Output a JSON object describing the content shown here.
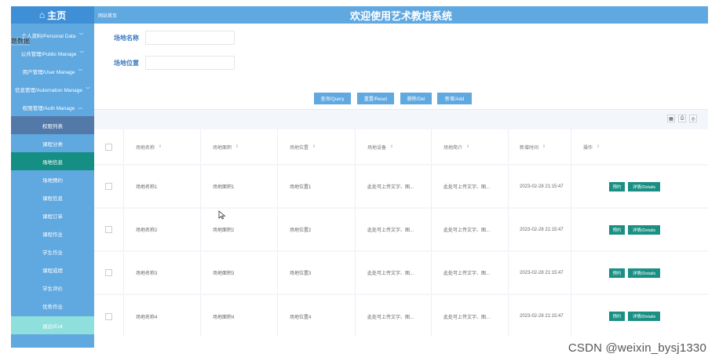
{
  "sidebar": {
    "title": "主页",
    "home_icon": "home-icon",
    "overlay_label": "题数据",
    "sections": [
      {
        "label": "个人资料/Personal Data"
      },
      {
        "label": "公共管理/Public Manage"
      },
      {
        "label": "用户管理/User Manage"
      },
      {
        "label": "信息管理/Automation Manage"
      },
      {
        "label": "权限管理/Auth Manage"
      }
    ],
    "items": [
      {
        "label": "权限列表"
      },
      {
        "label": "课程分类"
      },
      {
        "label": "场地信息"
      },
      {
        "label": "场地预约"
      },
      {
        "label": "课程信息"
      },
      {
        "label": "课程订单"
      },
      {
        "label": "课程作业"
      },
      {
        "label": "学生作业"
      },
      {
        "label": "课程成绩"
      },
      {
        "label": "学生评价"
      },
      {
        "label": "优秀作业"
      },
      {
        "label": "退出/Exit"
      }
    ]
  },
  "header": {
    "breadcrumb": "网站首页",
    "title": "欢迎使用艺术教培系统"
  },
  "filters": {
    "venue_name_label": "场地名称",
    "venue_name_value": "",
    "venue_location_label": "场地位置",
    "venue_location_value": ""
  },
  "actions": {
    "query": "查询/Query",
    "reset": "重置/Reset",
    "delete": "删除/Del",
    "add": "新增/Add"
  },
  "table": {
    "columns": [
      "场地名称",
      "场地面积",
      "场地位置",
      "场地设备",
      "场地简介",
      "新增时间",
      "操作"
    ],
    "sort_symbol": "⇕",
    "rows": [
      {
        "name": "场地名称1",
        "area": "场地面积1",
        "location": "场地位置1",
        "equipment": "此处可上传文字、图...",
        "intro": "此处可上传文字、图...",
        "time": "2023-02-28 21:15:47"
      },
      {
        "name": "场地名称2",
        "area": "场地面积2",
        "location": "场地位置2",
        "equipment": "此处可上传文字、图...",
        "intro": "此处可上传文字、图...",
        "time": "2023-02-28 21:15:47"
      },
      {
        "name": "场地名称3",
        "area": "场地面积3",
        "location": "场地位置3",
        "equipment": "此处可上传文字、图...",
        "intro": "此处可上传文字、图...",
        "time": "2023-02-28 21:15:47"
      },
      {
        "name": "场地名称4",
        "area": "场地面积4",
        "location": "场地位置4",
        "equipment": "此处可上传文字、图...",
        "intro": "此处可上传文字、图...",
        "time": "2023-02-28 21:15:47"
      }
    ],
    "row_actions": {
      "book": "预约",
      "details": "详情/Details"
    }
  },
  "toolbar_icons": [
    "column-toggle-icon",
    "print-icon",
    "export-icon"
  ],
  "watermark": "CSDN @weixin_bysj1330",
  "colors": {
    "primary": "#5fa8e0",
    "sidebar_dark": "#3f8fd6",
    "active_item": "#158f84",
    "action_green": "#1a8f84",
    "exit_item": "#8fe0dc"
  }
}
